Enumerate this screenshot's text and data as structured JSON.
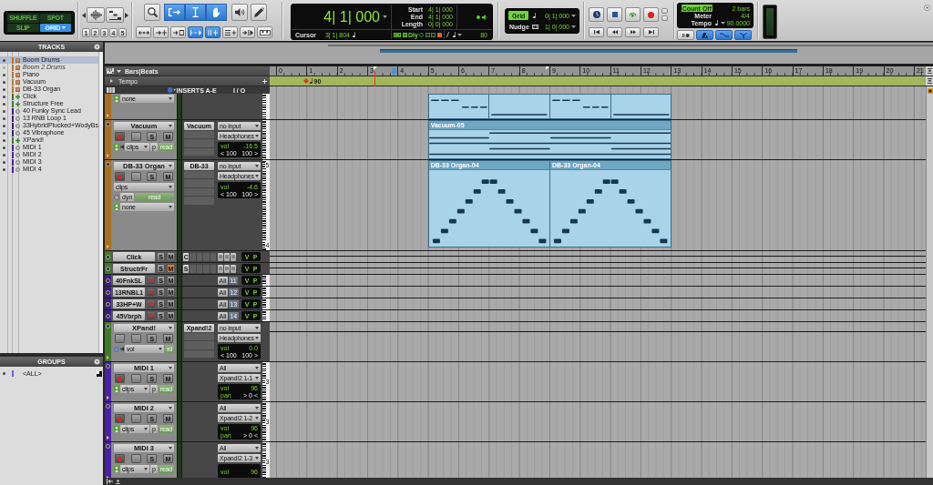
{
  "toolbar": {
    "edit_modes": [
      {
        "label": "SHUFFLE",
        "selected": false
      },
      {
        "label": "SPOT",
        "selected": false
      },
      {
        "label": "SLIP",
        "selected": false
      },
      {
        "label": "GRID",
        "selected": true
      }
    ],
    "zoom_buttons": [
      {
        "kind": "left"
      },
      {
        "kind": "audio"
      },
      {
        "kind": "midi"
      },
      {
        "kind": "right"
      }
    ],
    "zoom_presets": [
      "1",
      "2",
      "3",
      "4",
      "5"
    ],
    "tools": [
      {
        "kind": "zoom",
        "selected": false
      },
      {
        "kind": "trim",
        "selected": true
      },
      {
        "kind": "selector",
        "selected": true
      },
      {
        "kind": "grabber",
        "selected": true
      },
      {
        "kind": "scrub",
        "selected": false
      },
      {
        "kind": "pencil",
        "selected": false
      }
    ],
    "edit_options": [
      {
        "kind": "spread",
        "selected": false
      },
      {
        "kind": "tab",
        "selected": false
      },
      {
        "kind": "insert",
        "selected": false
      },
      {
        "kind": "link",
        "selected": true
      },
      {
        "kind": "lock",
        "selected": true
      },
      {
        "kind": "equal",
        "selected": false
      },
      {
        "kind": "follow",
        "selected": false
      },
      {
        "kind": "keys",
        "selected": false
      }
    ],
    "counter": {
      "main": "4| 1| 000",
      "rows": [
        {
          "label": "Start",
          "value": "4| 1| 000"
        },
        {
          "label": "End",
          "value": "4| 1| 000"
        },
        {
          "label": "Length",
          "value": "0| 0| 000"
        }
      ],
      "cursor_label": "Cursor",
      "cursor": "3| 1| 804",
      "delay_label": "Dly",
      "tempo_value": "80"
    },
    "grid": [
      {
        "label": "Grid",
        "value": "0| 1| 000",
        "on": true
      },
      {
        "label": "Nudge",
        "value": "1| 0| 000",
        "on": false
      }
    ],
    "transport": [
      {
        "kind": "online"
      },
      {
        "kind": "stop"
      },
      {
        "kind": "play"
      },
      {
        "kind": "record"
      }
    ],
    "locate": [
      {
        "kind": "start"
      },
      {
        "kind": "rewind"
      },
      {
        "kind": "forward"
      },
      {
        "kind": "end"
      }
    ],
    "tempo_box": [
      {
        "label": "Count Off",
        "value": "2 bars",
        "on": true
      },
      {
        "label": "Meter",
        "value": "4/4",
        "on": false
      },
      {
        "label": "Tempo",
        "value": "90.0000",
        "on": false
      }
    ],
    "midi_buttons": [
      {
        "kind": "wait",
        "selected": false
      },
      {
        "kind": "click",
        "selected": true
      },
      {
        "kind": "countoff",
        "selected": true
      },
      {
        "kind": "merge",
        "selected": true
      }
    ]
  },
  "tracks_panel": {
    "title": "TRACKS",
    "items": [
      {
        "name": "Boom Drums",
        "kind": "instrument",
        "color": "#b8782e",
        "shown": true,
        "selected": true
      },
      {
        "name": "Boom 2 Drums",
        "kind": "instrument",
        "color": "#b8782e",
        "shown": false,
        "selected": false
      },
      {
        "name": "Piano",
        "kind": "instrument",
        "color": "#b8782e",
        "shown": true,
        "selected": false
      },
      {
        "name": "Vacuum",
        "kind": "instrument",
        "color": "#b8782e",
        "shown": true,
        "selected": false
      },
      {
        "name": "DB-33 Organ",
        "kind": "instrument",
        "color": "#b8782e",
        "shown": true,
        "selected": false
      },
      {
        "name": "Click",
        "kind": "aux",
        "color": "#3f7a28",
        "shown": true,
        "selected": false
      },
      {
        "name": "Structure Free",
        "kind": "aux",
        "color": "#3f7a28",
        "shown": true,
        "selected": false
      },
      {
        "name": "40 Funky Sync Lead",
        "kind": "midi",
        "color": "#3c1d84",
        "shown": true,
        "selected": false
      },
      {
        "name": "13 RNB Loop 1",
        "kind": "midi",
        "color": "#3c1d84",
        "shown": true,
        "selected": false
      },
      {
        "name": "33HybridPlucked+WodyBs",
        "kind": "midi",
        "color": "#3c1d84",
        "shown": true,
        "selected": false
      },
      {
        "name": "45 Vibraphone",
        "kind": "midi",
        "color": "#3c1d84",
        "shown": true,
        "selected": false
      },
      {
        "name": "XPand!",
        "kind": "aux",
        "color": "#3f7a28",
        "shown": true,
        "selected": false
      },
      {
        "name": "MIDI 1",
        "kind": "midi",
        "color": "#4a21a6",
        "shown": true,
        "selected": false
      },
      {
        "name": "MIDI 2",
        "kind": "midi",
        "color": "#4a21a6",
        "shown": true,
        "selected": false
      },
      {
        "name": "MIDI 3",
        "kind": "midi",
        "color": "#4a21a6",
        "shown": true,
        "selected": false
      },
      {
        "name": "MIDI 4",
        "kind": "midi",
        "color": "#4a21a6",
        "shown": true,
        "selected": false
      }
    ]
  },
  "groups_panel": {
    "title": "GROUPS",
    "items": [
      {
        "name": "<ALL>",
        "color": "#7a5ae0"
      }
    ]
  },
  "edit": {
    "rulers": [
      {
        "kind": "bars",
        "label": "Bars|Beats"
      },
      {
        "kind": "tempo",
        "label": "Tempo"
      }
    ],
    "bar_numbers": [
      "0",
      "1",
      "2",
      "3",
      "4",
      "5",
      "6",
      "7",
      "8",
      "9",
      "10",
      "11",
      "12",
      "13",
      "14",
      "15",
      "16",
      "17",
      "18",
      "19",
      "20",
      "21"
    ],
    "tempo_marker": "90",
    "columns": [
      "INSERTS A-E",
      "I / O"
    ],
    "tracks": [
      {
        "kind": "partial",
        "color": "#a86e22",
        "controls": [
          [
            {
              "kind": "person"
            },
            {
              "kind": "menu",
              "label": "none"
            }
          ]
        ],
        "keyboard": true,
        "volume_line": false,
        "clips": [
          {
            "kind": "dashes"
          },
          {
            "kind": "low"
          },
          {
            "kind": "dashes"
          },
          {
            "kind": "low"
          }
        ]
      },
      {
        "kind": "medium",
        "name": "Vacuum",
        "color": "#a86e22",
        "armed": false,
        "solo": {
          "label": "S",
          "on": false
        },
        "mute": {
          "label": "M",
          "on": false
        },
        "controls": [
          [
            {
              "kind": "person"
            },
            {
              "kind": "speaker"
            },
            {
              "kind": "menu",
              "label": "clips"
            },
            {
              "kind": "toggle",
              "label": "p"
            },
            {
              "kind": "mode",
              "label": "read"
            }
          ]
        ],
        "inserts": [
          "Vacuum"
        ],
        "io": {
          "input": "no input",
          "output": "Headphones",
          "vol_label": "vol",
          "vol": "-16.5",
          "pan_left": "< 100",
          "pan_right": "100 >"
        },
        "keyboard": true,
        "volume_line": false,
        "clips": [
          {
            "kind": "steps",
            "name": "Vacuum-05"
          }
        ]
      },
      {
        "kind": "large",
        "name": "DB-33 Organ",
        "color": "#a86e22",
        "armed": false,
        "solo": {
          "label": "S",
          "on": false
        },
        "mute": {
          "label": "M",
          "on": false
        },
        "controls": [
          [
            {
              "kind": "menu",
              "label": "clips"
            }
          ],
          [
            {
              "kind": "ring"
            },
            {
              "kind": "toggle",
              "label": "dyn"
            },
            {
              "kind": "mode",
              "label": "read"
            }
          ],
          [
            {
              "kind": "person"
            },
            {
              "kind": "menu",
              "label": "none"
            }
          ]
        ],
        "inserts": [
          "DB-33"
        ],
        "io": {
          "input": "no input",
          "output": "Headphones",
          "vol_label": "vol",
          "vol": "-4.6",
          "pan_left": "< 100",
          "pan_right": "100 >"
        },
        "keyboard": true,
        "octaves": [
          "5",
          "4"
        ],
        "volume_line": false,
        "clips": [
          {
            "kind": "peak",
            "name": "DB-33 Organ-04"
          },
          {
            "kind": "peak",
            "name": "DB-33 Organ-04"
          }
        ]
      },
      {
        "kind": "mini",
        "name": "Click",
        "color": "#3f7a28",
        "solo": {
          "label": "S",
          "on": false
        },
        "mute": {
          "label": "M",
          "on": false
        },
        "inserts": [
          "C"
        ],
        "io": {
          "view": [
            "V",
            "P"
          ]
        },
        "keyboard": false,
        "volume_line": true
      },
      {
        "kind": "mini",
        "name": "StructrFr",
        "color": "#3f7a28",
        "solo": {
          "label": "S",
          "on": false
        },
        "mute": {
          "label": "M",
          "on": true
        },
        "inserts": [
          "S"
        ],
        "io": {
          "view": [
            "V",
            "P"
          ]
        },
        "keyboard": false,
        "volume_line": true
      },
      {
        "kind": "mini",
        "name": "40FnkSL",
        "color": "#3c1d84",
        "armed": false,
        "solo": {
          "label": "S",
          "on": false
        },
        "mute": {
          "label": "M",
          "on": false
        },
        "io": {
          "input": "All",
          "output": "11",
          "view": [
            "V",
            "P"
          ]
        },
        "keyboard": true,
        "volume_line": false
      },
      {
        "kind": "mini",
        "name": "13RNBL1",
        "color": "#3c1d84",
        "armed": false,
        "solo": {
          "label": "S",
          "on": false
        },
        "mute": {
          "label": "M",
          "on": false
        },
        "io": {
          "input": "All",
          "output": "12",
          "view": [
            "V",
            "P"
          ]
        },
        "keyboard": true,
        "volume_line": false
      },
      {
        "kind": "mini",
        "name": "33HP+W",
        "color": "#3c1d84",
        "armed": false,
        "solo": {
          "label": "S",
          "on": false
        },
        "mute": {
          "label": "M",
          "on": false
        },
        "io": {
          "input": "All",
          "output": "13",
          "view": [
            "V",
            "P"
          ]
        },
        "keyboard": true,
        "volume_line": false
      },
      {
        "kind": "mini",
        "name": "45Vbrph",
        "color": "#3c1d84",
        "armed": false,
        "solo": {
          "label": "S",
          "on": false
        },
        "mute": {
          "label": "M",
          "on": false
        },
        "io": {
          "input": "All",
          "output": "14",
          "view": [
            "V",
            "P"
          ]
        },
        "keyboard": true,
        "volume_line": false
      },
      {
        "kind": "medium",
        "name": "XPand!",
        "color": "#3f7a28",
        "solo": {
          "label": "S",
          "on": false
        },
        "mute": {
          "label": "M",
          "on": false
        },
        "controls": [
          [
            {
              "kind": "lock"
            },
            {
              "kind": "speaker"
            },
            {
              "kind": "menu",
              "label": "vol"
            },
            {
              "kind": "mode",
              "label": "rd"
            }
          ]
        ],
        "inserts": [
          "Xpand!2"
        ],
        "io": {
          "input": "no input",
          "output": "Headphones",
          "vol_label": "vol",
          "vol": "0.0",
          "pan_left": "< 100",
          "pan_right": "100 >"
        },
        "keyboard": false,
        "volume_line": true
      },
      {
        "kind": "medium",
        "name": "MIDI 1",
        "color": "#4a21a6",
        "armed": false,
        "solo": {
          "label": "S",
          "on": false
        },
        "mute": {
          "label": "M",
          "on": false
        },
        "controls": [
          [
            {
              "kind": "person"
            },
            {
              "kind": "menu",
              "label": "clips"
            },
            {
              "kind": "toggle",
              "label": "p"
            },
            {
              "kind": "mode",
              "label": "read"
            }
          ]
        ],
        "io": {
          "input": "All",
          "output": "Xpand!2 1-1",
          "vol_label": "vol",
          "vol": "96",
          "pan_label": "pan",
          "pan": "> 0 <"
        },
        "keyboard": true,
        "octaves": [
          "3"
        ],
        "volume_line": false
      },
      {
        "kind": "medium",
        "name": "MIDI 2",
        "color": "#4a21a6",
        "armed": false,
        "solo": {
          "label": "S",
          "on": false
        },
        "mute": {
          "label": "M",
          "on": false
        },
        "controls": [
          [
            {
              "kind": "person"
            },
            {
              "kind": "menu",
              "label": "clips"
            },
            {
              "kind": "toggle",
              "label": "p"
            },
            {
              "kind": "mode",
              "label": "read"
            }
          ]
        ],
        "io": {
          "input": "All",
          "output": "Xpand!2 1-2",
          "vol_label": "vol",
          "vol": "96",
          "pan_label": "pan",
          "pan": "> 0 <"
        },
        "keyboard": true,
        "octaves": [
          "3"
        ],
        "volume_line": false
      },
      {
        "kind": "medium",
        "name": "MIDI 3",
        "color": "#4a21a6",
        "armed": false,
        "solo": {
          "label": "S",
          "on": false
        },
        "mute": {
          "label": "M",
          "on": false
        },
        "controls": [
          [
            {
              "kind": "person"
            },
            {
              "kind": "menu",
              "label": "clips"
            },
            {
              "kind": "toggle",
              "label": "p"
            },
            {
              "kind": "mode",
              "label": "read"
            }
          ]
        ],
        "io": {
          "input": "All",
          "output": "Xpand!2 1-3",
          "vol_label": "vol",
          "vol": "96"
        },
        "keyboard": true,
        "octaves": [
          "3"
        ],
        "volume_line": false
      }
    ]
  }
}
